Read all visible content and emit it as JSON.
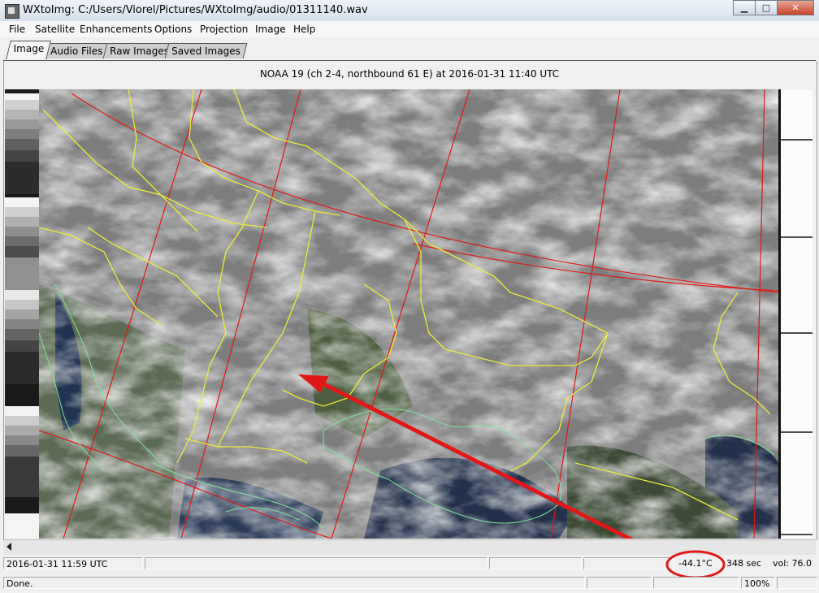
{
  "window": {
    "title": "WXtoImg: C:/Users/Viorel/Pictures/WXtoImg/audio/01311140.wav",
    "buttons": {
      "minimize": "▁",
      "maximize": "□",
      "close": "✕"
    }
  },
  "menu": [
    "File",
    "Satellite",
    "Enhancements",
    "Options",
    "Projection",
    "Image",
    "Help"
  ],
  "tabs": [
    "Image",
    "Audio Files",
    "Raw Images",
    "Saved Images"
  ],
  "image": {
    "caption": "NOAA 19 (ch 2-4, northbound 61 E) at 2016-01-31  11:40 UTC"
  },
  "status": {
    "time": "2016-01-31  11:59 UTC",
    "temperature": "-44.1°C",
    "duration": "348 sec",
    "volume": "vol: 76.0",
    "message": "Done.",
    "zoom": "100%"
  },
  "colors": {
    "border_yellow": "#ecec3a",
    "grid_red": "#e01818",
    "coast_green": "#7fe3a0",
    "annotation_red": "#e01818"
  }
}
